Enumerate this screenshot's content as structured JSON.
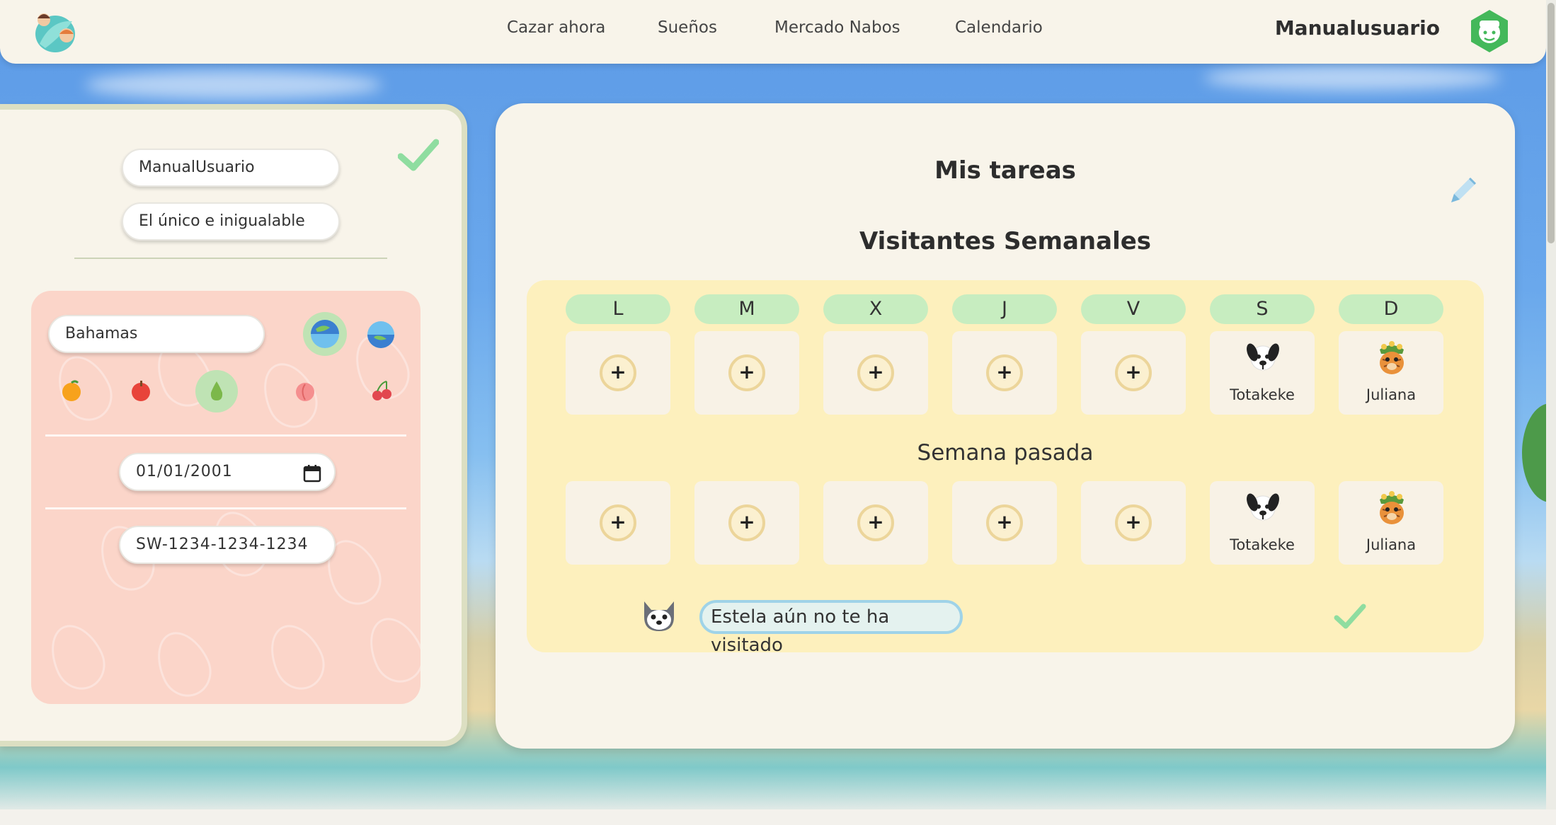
{
  "navbar": {
    "links": [
      "Cazar ahora",
      "Sueños",
      "Mercado Nabos",
      "Calendario"
    ],
    "username": "Manualusuario"
  },
  "profile": {
    "name_value": "ManualUsuario",
    "title_value": "El único e inigualable",
    "island_value": "Bahamas",
    "hemispheres": [
      "hemisphere-north-icon",
      "hemisphere-south-icon"
    ],
    "fruits": [
      "orange-icon",
      "apple-icon",
      "pear-icon",
      "peach-icon",
      "cherry-icon"
    ],
    "selected_fruit": "pear-icon",
    "birthday_value": "01/01/2001",
    "friend_code_value": "SW-1234-1234-1234"
  },
  "tasks": {
    "title": "Mis tareas",
    "weekly_title": "Visitantes Semanales",
    "days": [
      "L",
      "M",
      "X",
      "J",
      "V",
      "S",
      "D"
    ],
    "this_week": [
      {
        "type": "add",
        "label": "+"
      },
      {
        "type": "add",
        "label": "+"
      },
      {
        "type": "add",
        "label": "+"
      },
      {
        "type": "add",
        "label": "+"
      },
      {
        "type": "add",
        "label": "+"
      },
      {
        "type": "villager",
        "name": "Totakeke",
        "icon": "totakeke-icon"
      },
      {
        "type": "villager",
        "name": "Juliana",
        "icon": "juliana-icon"
      }
    ],
    "last_week_title": "Semana pasada",
    "last_week": [
      {
        "type": "add",
        "label": "+"
      },
      {
        "type": "add",
        "label": "+"
      },
      {
        "type": "add",
        "label": "+"
      },
      {
        "type": "add",
        "label": "+"
      },
      {
        "type": "add",
        "label": "+"
      },
      {
        "type": "villager",
        "name": "Totakeke",
        "icon": "totakeke-icon"
      },
      {
        "type": "villager",
        "name": "Juliana",
        "icon": "juliana-icon"
      }
    ],
    "visit_message": "Estela aún no te ha visitado"
  },
  "colors": {
    "card_bg": "#f8f4ea",
    "day_pill": "#c7edc0",
    "panel_pink": "#fbd5c9",
    "panel_yellow": "#fdf0bd",
    "check_green": "#8fdda0"
  }
}
